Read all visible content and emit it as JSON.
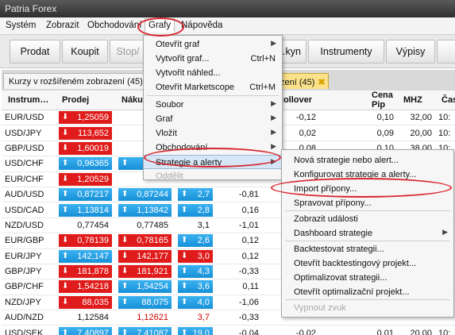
{
  "window": {
    "title": "Patria Forex"
  },
  "menubar": [
    "Systém",
    "Zobrazit",
    "Obchodování",
    "Grafy",
    "Nápověda"
  ],
  "toolbar": {
    "buttons": [
      "Prodat",
      "Koupit",
      "Stop/",
      "…kyn",
      "Instrumenty",
      "Výpisy"
    ]
  },
  "tabs": {
    "tab1": "Kurzy v rozšířeném zobrazení (45)",
    "tab2": "zení (45)"
  },
  "table": {
    "headers": [
      "Instrum…",
      "Prodej",
      "Náku",
      "",
      "",
      "N Rollover",
      "",
      "Cena Pip",
      "MHZ",
      "Čas"
    ],
    "rows": [
      {
        "symbol": "EUR/USD",
        "sell": "1,25059",
        "sell_dir": "down",
        "sell_color": "red",
        "buy": "",
        "buy_dir": "",
        "buy_color": "",
        "spread": "",
        "spread_color": "",
        "roll1": "",
        "roll2": "-0,12",
        "pip": "0,10",
        "mhz": "32,00",
        "time": "10:"
      },
      {
        "symbol": "USD/JPY",
        "sell": "113,652",
        "sell_dir": "down",
        "sell_color": "red",
        "buy": "",
        "buy_dir": "",
        "buy_color": "",
        "spread": "",
        "spread_color": "",
        "roll1": "",
        "roll2": "0,02",
        "pip": "0,09",
        "mhz": "20,00",
        "time": "10:"
      },
      {
        "symbol": "GBP/USD",
        "sell": "1,60019",
        "sell_dir": "down",
        "sell_color": "red",
        "buy": "",
        "buy_dir": "",
        "buy_color": "",
        "spread": "",
        "spread_color": "",
        "roll1": "",
        "roll2": "0,08",
        "pip": "0,10",
        "mhz": "38,00",
        "time": "10:"
      },
      {
        "symbol": "USD/CHF",
        "sell": "0,96365",
        "sell_dir": "up",
        "sell_color": "blue",
        "buy": "0,96",
        "buy_dir": "up",
        "buy_color": "blue",
        "spread": "",
        "spread_color": "",
        "roll1": "",
        "roll2": "",
        "pip": "",
        "mhz": "",
        "time": ""
      },
      {
        "symbol": "EUR/CHF",
        "sell": "1,20529",
        "sell_dir": "down",
        "sell_color": "red",
        "buy": "",
        "buy_dir": "",
        "buy_color": "",
        "spread": "",
        "spread_color": "",
        "roll1": "",
        "roll2": "",
        "pip": "",
        "mhz": "",
        "time": ""
      },
      {
        "symbol": "AUD/USD",
        "sell": "0,87217",
        "sell_dir": "up",
        "sell_color": "blue",
        "buy": "0,87244",
        "buy_dir": "up",
        "buy_color": "blue",
        "spread": "2,7",
        "spread_color": "blue",
        "roll1": "-0,81",
        "roll2": "",
        "pip": "",
        "mhz": "",
        "time": ""
      },
      {
        "symbol": "USD/CAD",
        "sell": "1,13814",
        "sell_dir": "up",
        "sell_color": "blue",
        "buy": "1,13842",
        "buy_dir": "up",
        "buy_color": "blue",
        "spread": "2,8",
        "spread_color": "blue",
        "roll1": "0,16",
        "roll2": "",
        "pip": "",
        "mhz": "",
        "time": ""
      },
      {
        "symbol": "NZD/USD",
        "sell": "0,77454",
        "sell_dir": "",
        "sell_color": "plain",
        "buy": "0,77485",
        "buy_dir": "",
        "buy_color": "plain",
        "spread": "3,1",
        "spread_color": "plain",
        "roll1": "-1,01",
        "roll2": "",
        "pip": "",
        "mhz": "",
        "time": ""
      },
      {
        "symbol": "EUR/GBP",
        "sell": "0,78139",
        "sell_dir": "down",
        "sell_color": "red",
        "buy": "0,78165",
        "buy_dir": "down",
        "buy_color": "red",
        "spread": "2,6",
        "spread_color": "blue",
        "roll1": "0,12",
        "roll2": "",
        "pip": "",
        "mhz": "",
        "time": ""
      },
      {
        "symbol": "EUR/JPY",
        "sell": "142,147",
        "sell_dir": "up",
        "sell_color": "blue",
        "buy": "142,177",
        "buy_dir": "down",
        "buy_color": "red",
        "spread": "3,0",
        "spread_color": "red",
        "roll1": "0,12",
        "roll2": "",
        "pip": "",
        "mhz": "",
        "time": ""
      },
      {
        "symbol": "GBP/JPY",
        "sell": "181,878",
        "sell_dir": "down",
        "sell_color": "red",
        "buy": "181,921",
        "buy_dir": "down",
        "buy_color": "red",
        "spread": "4,3",
        "spread_color": "blue",
        "roll1": "-0,33",
        "roll2": "",
        "pip": "",
        "mhz": "",
        "time": ""
      },
      {
        "symbol": "GBP/CHF",
        "sell": "1,54218",
        "sell_dir": "down",
        "sell_color": "red",
        "buy": "1,54254",
        "buy_dir": "up",
        "buy_color": "blue",
        "spread": "3,6",
        "spread_color": "blue",
        "roll1": "0,11",
        "roll2": "",
        "pip": "",
        "mhz": "",
        "time": ""
      },
      {
        "symbol": "NZD/JPY",
        "sell": "88,035",
        "sell_dir": "down",
        "sell_color": "red",
        "buy": "88,075",
        "buy_dir": "up",
        "buy_color": "blue",
        "spread": "4,0",
        "spread_color": "blue",
        "roll1": "-1,06",
        "roll2": "",
        "pip": "",
        "mhz": "",
        "time": ""
      },
      {
        "symbol": "AUD/NZD",
        "sell": "1,12584",
        "sell_dir": "",
        "sell_color": "plain",
        "buy": "1,12621",
        "buy_dir": "",
        "buy_color": "plaintextred",
        "spread": "3,7",
        "spread_color": "plaintextred",
        "roll1": "-0,33",
        "roll2": "",
        "pip": "",
        "mhz": "",
        "time": ""
      },
      {
        "symbol": "USD/SEK",
        "sell": "7,40897",
        "sell_dir": "up",
        "sell_color": "blue",
        "buy": "7,41087",
        "buy_dir": "up",
        "buy_color": "blue",
        "spread": "19,0",
        "spread_color": "blue",
        "roll1": "-0,04",
        "roll2": "-0,02",
        "pip": "0,01",
        "mhz": "20,00",
        "time": "10:"
      }
    ]
  },
  "grafy_menu": {
    "items": [
      {
        "label": "Otevřít graf",
        "shortcut": "",
        "submenu": true
      },
      {
        "label": "Vytvořit graf...",
        "shortcut": "Ctrl+N",
        "submenu": false
      },
      {
        "label": "Vytvořit náhled...",
        "shortcut": "",
        "submenu": false
      },
      {
        "label": "Otevřít Marketscope",
        "shortcut": "Ctrl+M",
        "submenu": false
      },
      {
        "label": "Soubor",
        "shortcut": "",
        "submenu": true
      },
      {
        "label": "Graf",
        "shortcut": "",
        "submenu": true
      },
      {
        "label": "Vložit",
        "shortcut": "",
        "submenu": true
      },
      {
        "label": "Obchodování",
        "shortcut": "",
        "submenu": true
      },
      {
        "label": "Strategie a alerty",
        "shortcut": "",
        "submenu": true
      },
      {
        "label": "Oddělit",
        "shortcut": "",
        "submenu": false
      }
    ]
  },
  "strategy_menu": {
    "items": [
      {
        "label": "Nová strategie nebo alert...",
        "submenu": false
      },
      {
        "label": "Konfigurovat strategie a alerty...",
        "submenu": false
      },
      {
        "label": "Import přípony...",
        "submenu": false
      },
      {
        "label": "Spravovat přípony...",
        "submenu": false
      },
      {
        "label": "Zobrazit události",
        "submenu": false
      },
      {
        "label": "Dashboard strategie",
        "submenu": true
      },
      {
        "label": "Backtestovat strategii...",
        "submenu": false
      },
      {
        "label": "Otevřít backtestingový projekt...",
        "submenu": false
      },
      {
        "label": "Optimalizovat strategii...",
        "submenu": false
      },
      {
        "label": "Otevřít optimalizační projekt...",
        "submenu": false
      },
      {
        "label": "Vypnout zvuk",
        "submenu": false
      }
    ]
  },
  "colors": {
    "sell_red": "#e01b1b",
    "buy_blue": "#1790d8",
    "highlight": "#d7262e",
    "tab_active": "#fbe18a"
  }
}
